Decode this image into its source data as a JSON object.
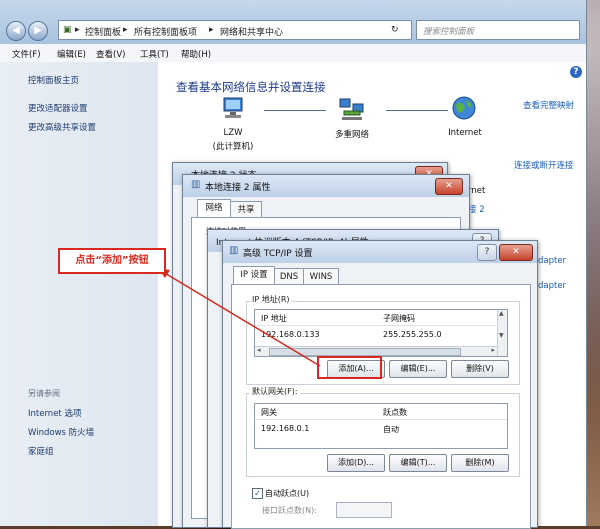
{
  "explorer": {
    "address": [
      "控制面板",
      "所有控制面板项",
      "网络和共享中心"
    ],
    "address_sep": "▸",
    "search_placeholder": "搜索控制面板",
    "menu": [
      "文件(F)",
      "编辑(E)",
      "查看(V)",
      "工具(T)",
      "帮助(H)"
    ],
    "sidebar": {
      "links": [
        "控制面板主页",
        "更改适配器设置",
        "更改高级共享设置"
      ],
      "see_also_title": "另请参阅",
      "see_also": [
        "Internet 选项",
        "Windows 防火墙",
        "家庭组"
      ]
    },
    "main": {
      "heading": "查看基本网络信息并设置连接",
      "view_full_map": "查看完整映射",
      "computer_name": "LZW",
      "computer_sub": "(此计算机)",
      "network_name": "多重网络",
      "internet_label": "Internet",
      "connect_disconnect": "连接或断开连接",
      "partial_right": [
        "rnet",
        "接 2",
        "dapter",
        "dapter"
      ]
    }
  },
  "dialog_status": {
    "title": "本地连接 2 状态"
  },
  "dialog_props": {
    "title": "本地连接 2 属性",
    "tabs": [
      "网络",
      "共享"
    ],
    "partial_text": "连接时使用:"
  },
  "dialog_ipv4": {
    "title": "Internet 协议版本 4 (TCP/IPv4) 属性"
  },
  "dialog_adv": {
    "title": "高级 TCP/IP 设置",
    "tabs": [
      "IP 设置",
      "DNS",
      "WINS"
    ],
    "ip_group_label": "IP 地址(R)",
    "ip_columns": [
      "IP 地址",
      "子网掩码"
    ],
    "ip_rows": [
      [
        "192.168.0.133",
        "255.255.255.0"
      ]
    ],
    "ip_buttons": [
      "添加(A)...",
      "编辑(E)...",
      "删除(V)"
    ],
    "gw_group_label": "默认网关(F):",
    "gw_columns": [
      "网关",
      "跃点数"
    ],
    "gw_rows": [
      [
        "192.168.0.1",
        "自动"
      ]
    ],
    "gw_buttons": [
      "添加(D)...",
      "编辑(T)...",
      "删除(M)"
    ],
    "auto_metric_label": "自动跃点(U)",
    "auto_metric_checked": true,
    "interface_metric_label": "接口跃点数(N):"
  },
  "annotation": {
    "callout_text": "点击“添加”按钮",
    "color": "#d9281f"
  }
}
